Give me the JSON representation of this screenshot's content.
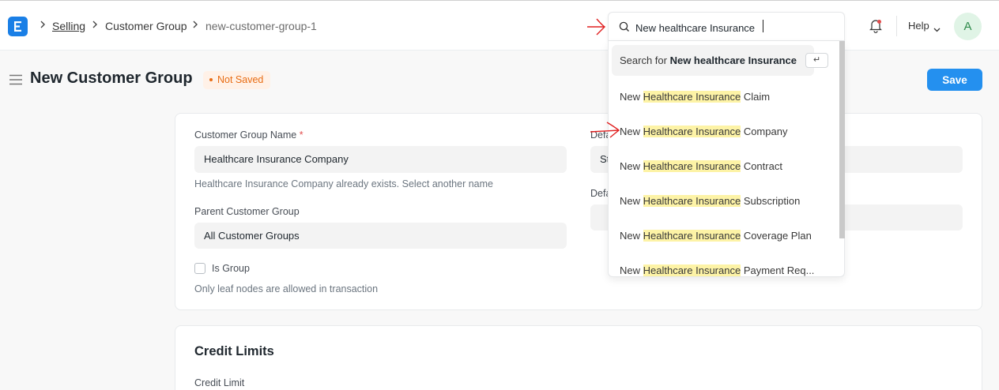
{
  "navbar": {
    "breadcrumbs": [
      "Selling",
      "Customer Group",
      "new-customer-group-1"
    ],
    "search_value": "New healthcare Insurance",
    "help_label": "Help",
    "avatar_initial": "A"
  },
  "page": {
    "title": "New Customer Group",
    "status": "Not Saved",
    "save_label": "Save"
  },
  "form": {
    "customer_group_name_label": "Customer Group Name",
    "required_mark": "*",
    "customer_group_name_value": "Healthcare Insurance Company",
    "name_help": "Healthcare Insurance Company already exists. Select another name",
    "parent_group_label": "Parent Customer Group",
    "parent_group_value": "All Customer Groups",
    "is_group_label": "Is Group",
    "is_group_help": "Only leaf nodes are allowed in transaction",
    "right_label_1": "Defa",
    "right_value_1": "St",
    "right_label_2": "Defa",
    "credit_section_title": "Credit Limits",
    "credit_limit_label": "Credit Limit"
  },
  "dropdown": {
    "search_for_prefix": "Search for ",
    "search_for_query": "New healthcare Insurance",
    "enter_key": "↵",
    "items": [
      {
        "prefix": "New ",
        "highlight": "Healthcare Insurance",
        "suffix": " Claim"
      },
      {
        "prefix": "New ",
        "highlight": "Healthcare Insurance",
        "suffix": " Company"
      },
      {
        "prefix": "New ",
        "highlight": "Healthcare Insurance",
        "suffix": " Contract"
      },
      {
        "prefix": "New ",
        "highlight": "Healthcare Insurance",
        "suffix": " Subscription"
      },
      {
        "prefix": "New ",
        "highlight": "Healthcare Insurance",
        "suffix": " Coverage Plan"
      },
      {
        "prefix": "New ",
        "highlight": "Healthcare Insurance",
        "suffix": " Payment Req..."
      }
    ]
  },
  "colors": {
    "primary": "#2490ef",
    "status_orange": "#e86c13",
    "highlight": "#fdf3a6",
    "annotation_red": "#e02020"
  }
}
